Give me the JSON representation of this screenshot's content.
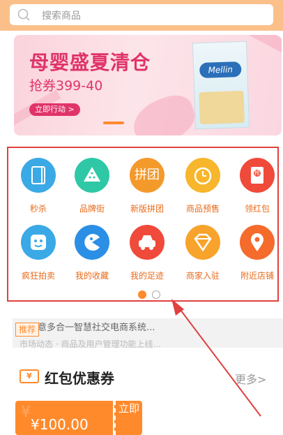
{
  "search": {
    "placeholder": "搜索商品"
  },
  "banner": {
    "title": "母婴盛夏清仓",
    "subtitle": "抢券399-40",
    "button": "立即行动 >",
    "product_brand": "Mellin"
  },
  "nav": {
    "row1": [
      {
        "label": "秒杀",
        "icon": "book-icon",
        "color": "#3aa9e6"
      },
      {
        "label": "品牌街",
        "icon": "watermelon-icon",
        "color": "#2fc8a6"
      },
      {
        "label": "新版拼团",
        "icon": "group-buy-icon",
        "color": "#f39a2b"
      },
      {
        "label": "商品预售",
        "icon": "clock-icon",
        "color": "#f7b62c"
      },
      {
        "label": "领红包",
        "icon": "red-envelope-icon",
        "color": "#f04a3a"
      }
    ],
    "row2": [
      {
        "label": "疯狂拍卖",
        "icon": "robot-face-icon",
        "color": "#3aa9e6"
      },
      {
        "label": "我的收藏",
        "icon": "pacman-icon",
        "color": "#2b8fe6"
      },
      {
        "label": "我的足迹",
        "icon": "car-icon",
        "color": "#f04a3a"
      },
      {
        "label": "商家入驻",
        "icon": "diamond-icon",
        "color": "#f7a32c"
      },
      {
        "label": "附近店铺",
        "icon": "location-pin-icon",
        "color": "#f46b2c"
      }
    ],
    "group_glyph": "拼团",
    "envelope_glyph": "抢"
  },
  "pager": {
    "active": 1,
    "count": 2
  },
  "news": {
    "tag": "推荐",
    "headline": "新海意多合一智慧社交电商系统...",
    "subline": "市场动态 · 商品及用户管理功能上线..."
  },
  "coupons": {
    "section_title": "红包优惠券",
    "more": "更多>",
    "ticket_glyph": "¥",
    "card_amount": "¥100.00",
    "card_button": "立即",
    "watermark": "¥"
  },
  "colors": {
    "accent": "#ff8a2c",
    "header": "#fbc08a",
    "highlight_border": "#e04040"
  }
}
